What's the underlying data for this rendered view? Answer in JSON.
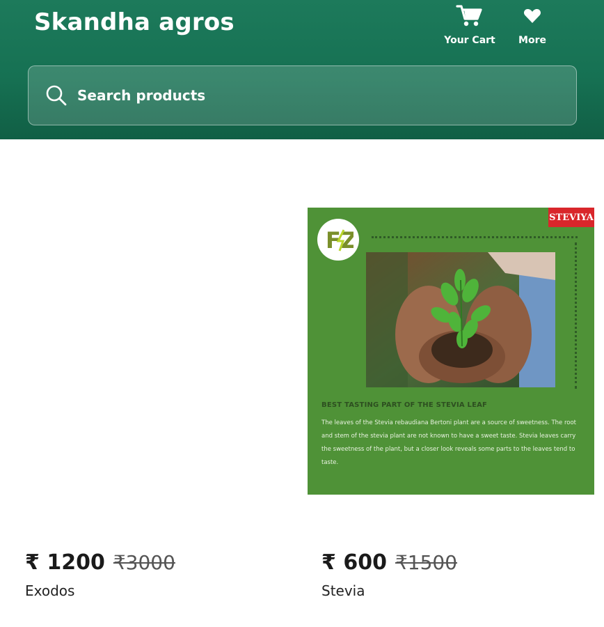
{
  "header": {
    "brand": "Skandha agros",
    "actions": [
      {
        "label": "Your Cart",
        "icon": "cart-icon"
      },
      {
        "label": "More",
        "icon": "heart-icon"
      }
    ],
    "search": {
      "placeholder": "Search products",
      "value": "",
      "icon": "search-icon"
    },
    "colors": {
      "background": "#167153",
      "text": "#ffffff"
    }
  },
  "products": [
    {
      "name": "Exodos",
      "price": "₹ 1200",
      "mrp": "₹3000",
      "image": "blank"
    },
    {
      "name": "Stevia",
      "price": "₹ 600",
      "mrp": "₹1500",
      "image": "stevia-card",
      "card": {
        "badge": "STEVIYA",
        "logo": "FZ",
        "heading": "BEST TASTING PART OF THE STEVIA LEAF",
        "body": "The leaves of the Stevia rebaudiana Bertoni plant are a source of sweetness. The root and stem of the stevia plant are not known to have a sweet taste. Stevia leaves carry the sweetness of the plant, but a closer look reveals some parts to the leaves tend to taste."
      }
    }
  ]
}
